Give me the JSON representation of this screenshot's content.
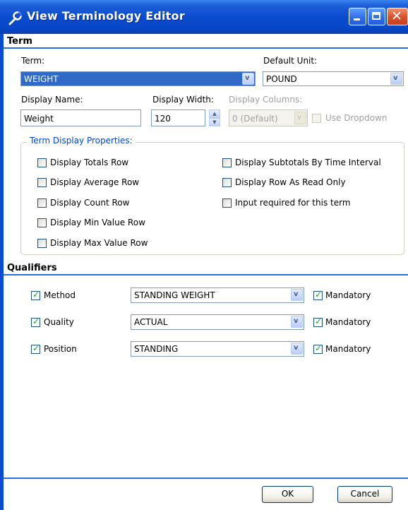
{
  "window": {
    "title": "View Terminology Editor"
  },
  "term_section": {
    "heading": "Term",
    "term_label": "Term:",
    "term_value": "WEIGHT",
    "default_unit_label": "Default Unit:",
    "default_unit_value": "POUND",
    "display_name_label": "Display Name:",
    "display_name_value": "Weight",
    "display_width_label": "Display Width:",
    "display_width_value": "120",
    "display_columns_label": "Display Columns:",
    "display_columns_value": "0 (Default)",
    "use_dropdown_label": "Use Dropdown"
  },
  "display_properties": {
    "legend": "Term Display Properties:",
    "left": [
      {
        "label": "Display Totals Row",
        "checked": false
      },
      {
        "label": "Display Average Row",
        "checked": false
      },
      {
        "label": "Display Count Row",
        "checked": false
      },
      {
        "label": "Display Min Value Row",
        "checked": false
      },
      {
        "label": "Display Max Value Row",
        "checked": false
      }
    ],
    "right": [
      {
        "label": "Display Subtotals By Time Interval",
        "checked": false
      },
      {
        "label": "Display Row As Read Only",
        "checked": false
      },
      {
        "label": "Input required for this term",
        "checked": false
      }
    ]
  },
  "qualifiers": {
    "heading": "Qualifiers",
    "rows": [
      {
        "name": "Method",
        "value": "STANDING WEIGHT",
        "mandatory_label": "Mandatory",
        "checked": true,
        "mandatory": true
      },
      {
        "name": "Quality",
        "value": "ACTUAL",
        "mandatory_label": "Mandatory",
        "checked": true,
        "mandatory": true
      },
      {
        "name": "Position",
        "value": "STANDING",
        "mandatory_label": "Mandatory",
        "checked": true,
        "mandatory": true
      }
    ]
  },
  "buttons": {
    "ok": "OK",
    "cancel": "Cancel"
  },
  "colors": {
    "titlebar": "#0a4cd0",
    "section_line": "#2c6fd6",
    "selection": "#3169c6",
    "legend": "#0046d5",
    "check": "#21a121"
  }
}
